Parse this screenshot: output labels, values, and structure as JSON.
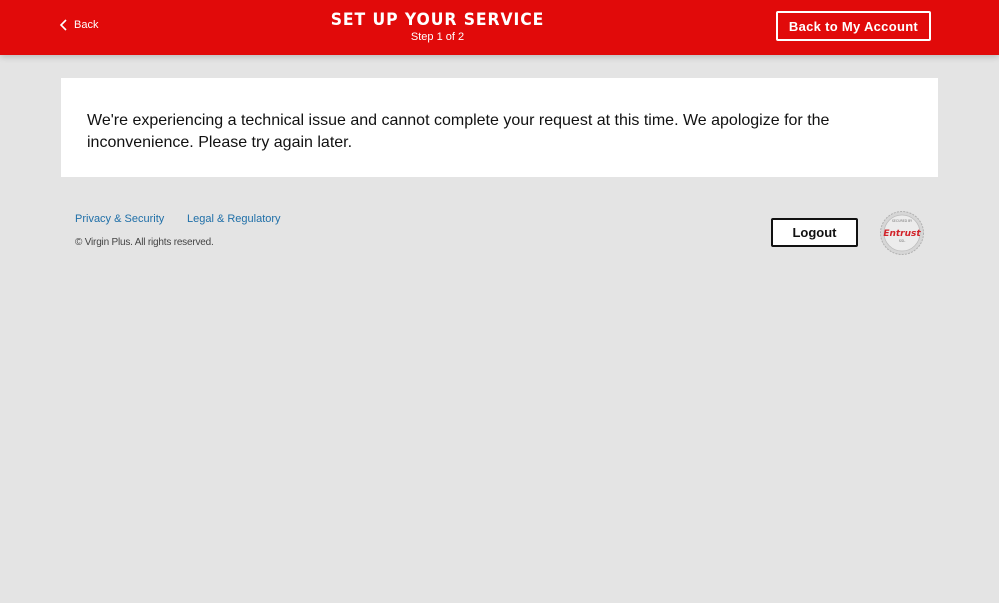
{
  "header": {
    "back_label": "Back",
    "title": "SET UP YOUR SERVICE",
    "step_text": "Step 1 of 2",
    "account_button_label": "Back to My Account"
  },
  "main": {
    "error_message": "We're experiencing a technical issue and cannot complete your request at this time. We apologize for the inconvenience. Please try again later."
  },
  "footer": {
    "links": [
      {
        "label": "Privacy & Security"
      },
      {
        "label": "Legal & Regulatory"
      }
    ],
    "copyright": "© Virgin Plus. All rights reserved.",
    "logout_label": "Logout",
    "seal": {
      "brand": "Entrust",
      "top_text": "SECURED BY",
      "sub_text": "SSL",
      "icon": "entrust-ssl-seal-icon"
    }
  },
  "colors": {
    "brand_red": "#e10a0a",
    "page_background": "#e4e4e4",
    "link_blue": "#1f6fa8"
  }
}
